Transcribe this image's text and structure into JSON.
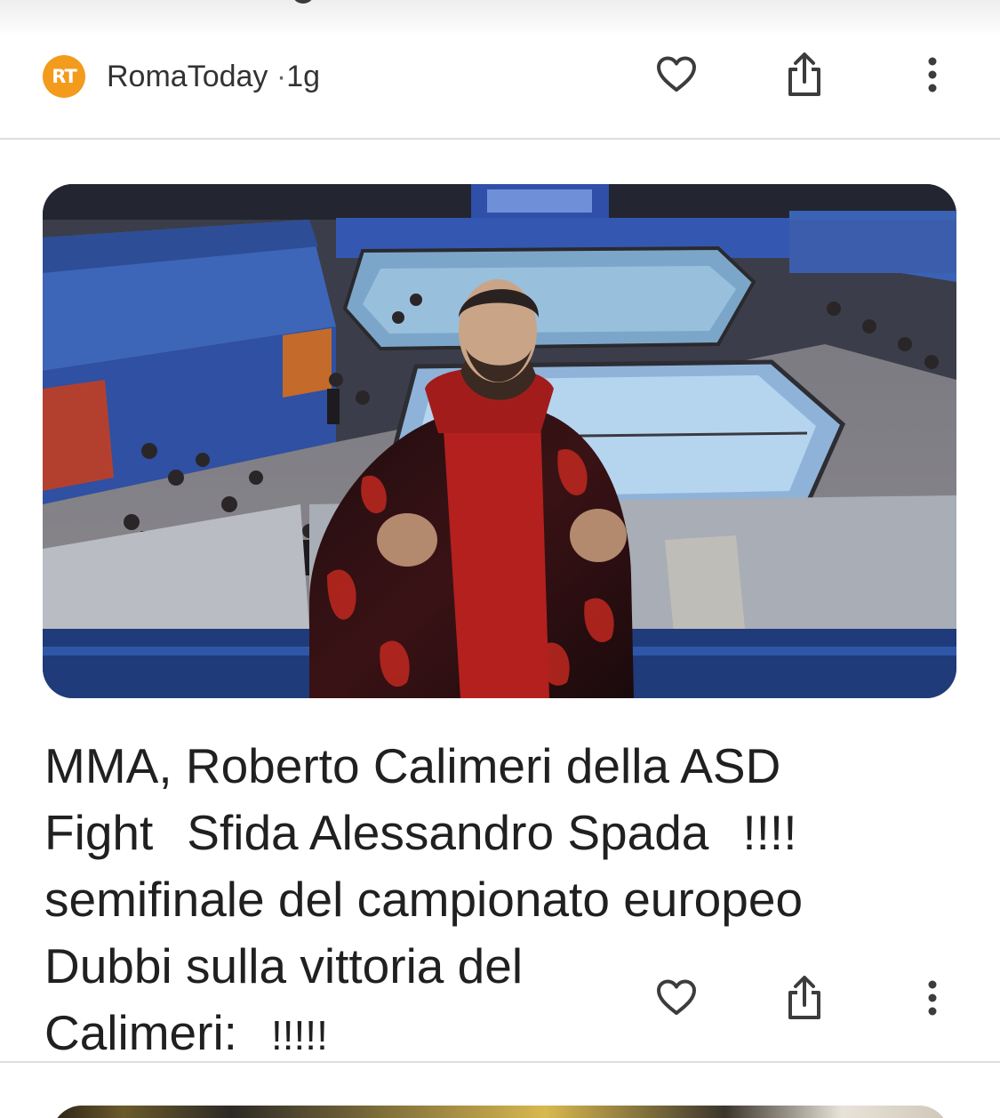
{
  "source": {
    "logo_text": "RT",
    "logo_color": "#f39b1c",
    "name": "RomaToday",
    "separator": "·",
    "age": "1g"
  },
  "actions": {
    "like_icon": "heart-icon",
    "share_icon": "share-icon",
    "more_icon": "more-vertical-icon"
  },
  "article": {
    "image_alt": "",
    "headline": {
      "line1": "MMA, Roberto Calimeri della ASD",
      "line2a": "Fight",
      "line2b": "Sfida Alessandro Spada",
      "line2c": "!!!!",
      "line3": "semifinale del campionato europeo",
      "line4": "Dubbi sulla vittoria del",
      "line5a": "Calimeri:",
      "line5b": "!!!!!"
    }
  }
}
